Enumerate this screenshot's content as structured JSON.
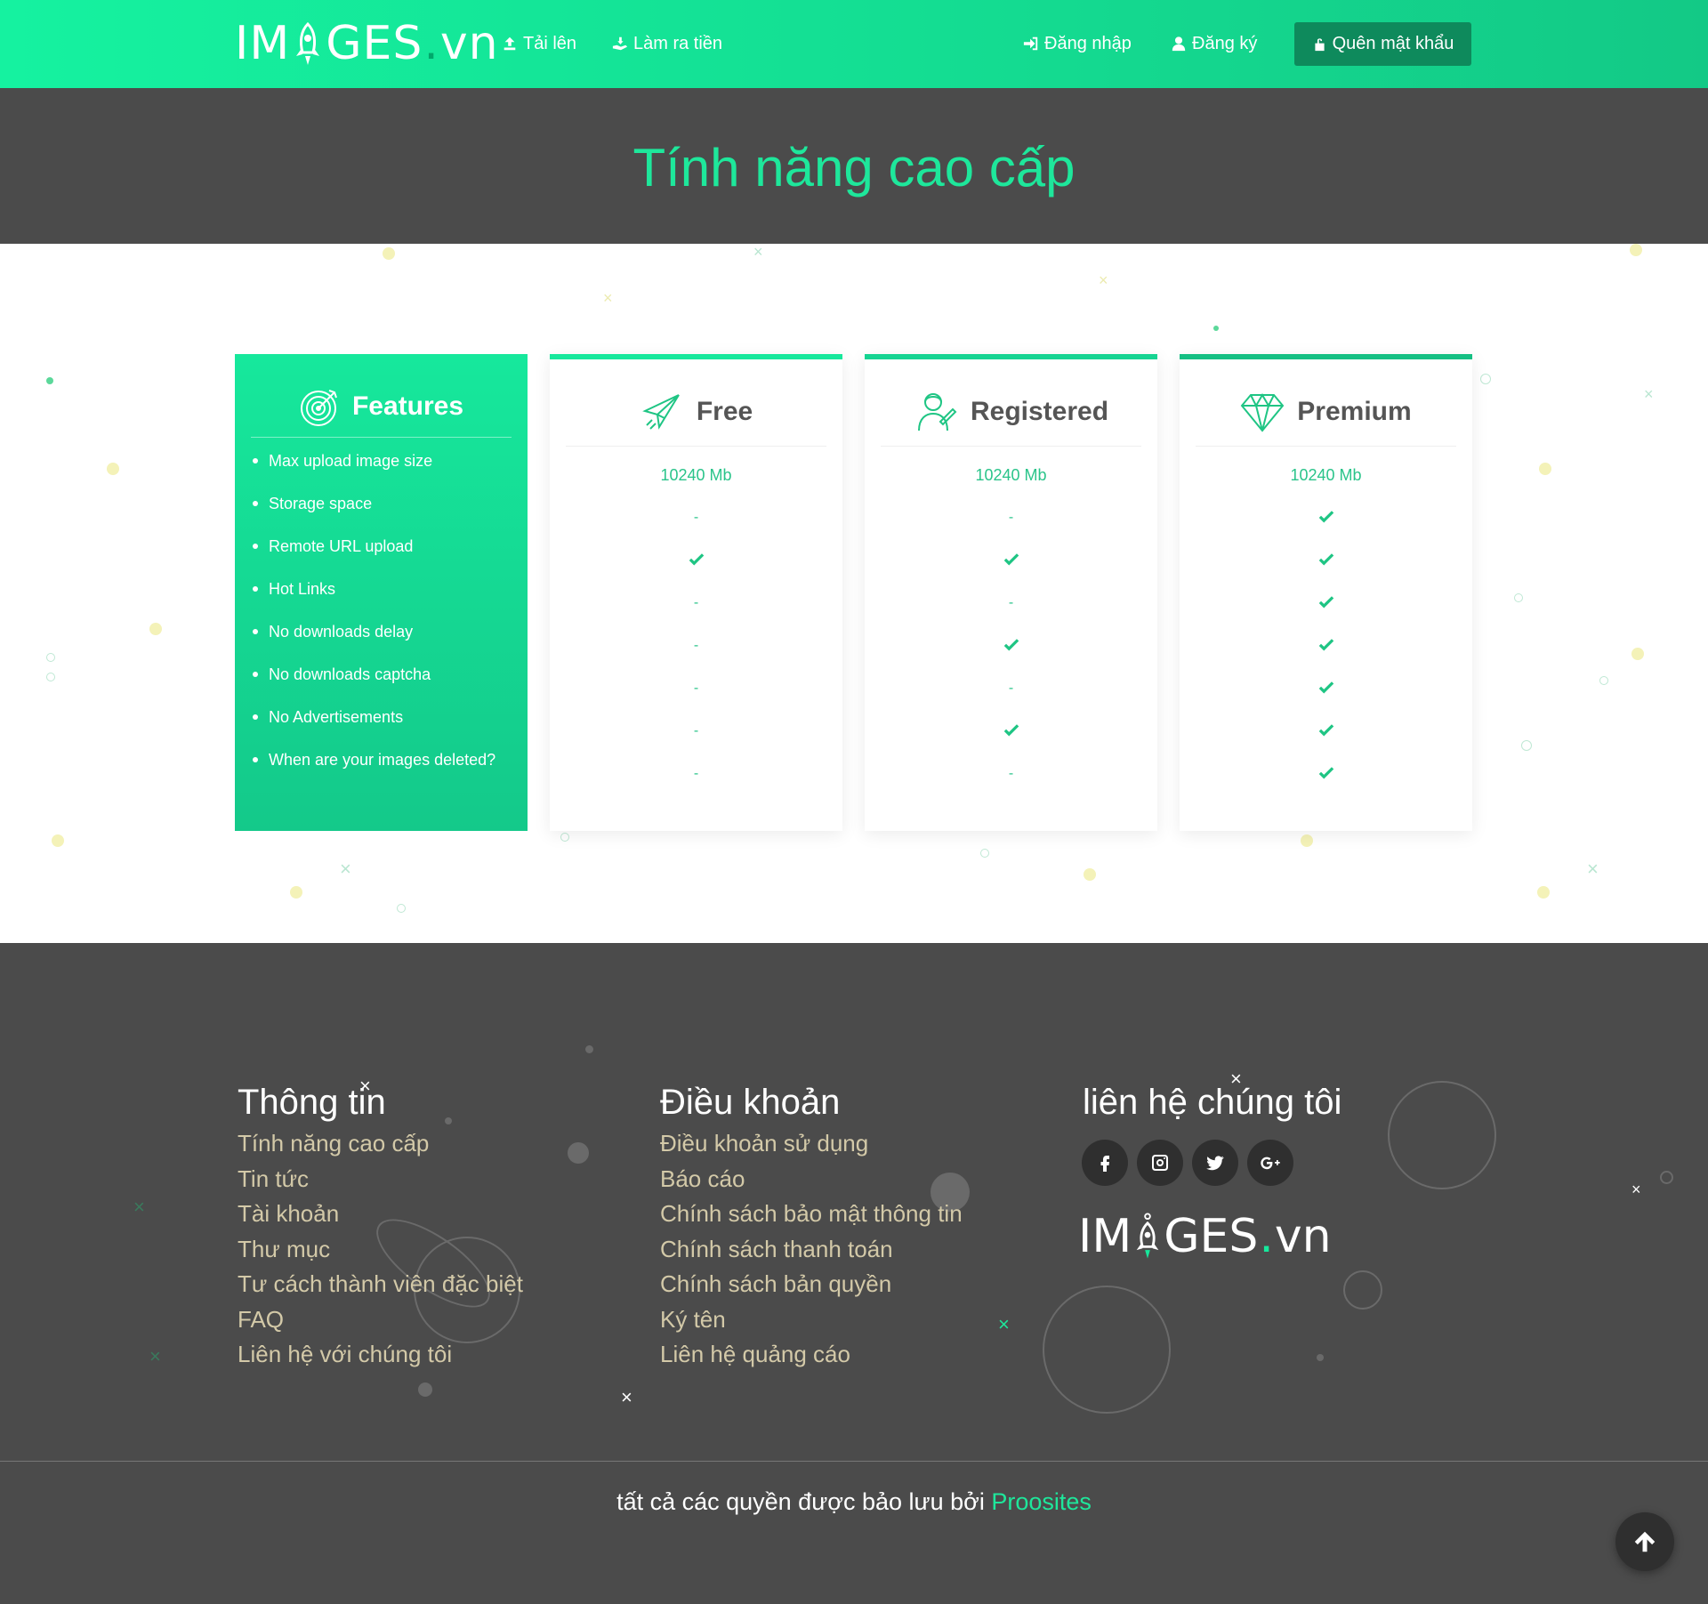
{
  "nav": {
    "logo": {
      "part1": "IM",
      "part2": "GES",
      "dot": ".",
      "tld": "vn"
    },
    "upload_label": "Tải lên",
    "earn_label": "Làm ra tiền",
    "login_label": "Đăng nhập",
    "register_label": "Đăng ký",
    "forgot_label": "Quên mật khẩu",
    "colors": {
      "bar": "#15f2a0",
      "button": "#0e8a5c"
    }
  },
  "hero": {
    "title": "Tính năng cao cấp"
  },
  "features": {
    "heading": "Features",
    "items": [
      "Max upload image size",
      "Storage space",
      "Remote URL upload",
      "Hot Links",
      "No downloads delay",
      "No downloads captcha",
      "No Advertisements",
      "When are your images deleted?"
    ]
  },
  "plans": [
    {
      "name": "Free",
      "icon": "paper-plane-icon",
      "size": "10240 Mb",
      "values": [
        "-",
        "check",
        "-",
        "-",
        "-",
        "-",
        "-"
      ]
    },
    {
      "name": "Registered",
      "icon": "user-icon",
      "size": "10240 Mb",
      "values": [
        "-",
        "check",
        "-",
        "check",
        "-",
        "check",
        "-"
      ]
    },
    {
      "name": "Premium",
      "icon": "diamond-icon",
      "size": "10240 Mb",
      "values": [
        "check",
        "check",
        "check",
        "check",
        "check",
        "check",
        "check"
      ]
    }
  ],
  "footer": {
    "info": {
      "title": "Thông tin",
      "links": [
        "Tính năng cao cấp",
        "Tin tức",
        "Tài khoản",
        "Thư mục",
        "Tư cách thành viên đặc biệt",
        "FAQ",
        "Liên hệ với chúng tôi"
      ]
    },
    "terms": {
      "title": "Điều khoản",
      "links": [
        "Điều khoản sử dụng",
        "Báo cáo",
        "Chính sách bảo mật thông tin",
        "Chính sách thanh toán",
        "Chính sách bản quyền",
        "Ký tên",
        "Liên hệ quảng cáo"
      ]
    },
    "contact": {
      "title": "liên hệ chúng tôi",
      "social": [
        "facebook-icon",
        "instagram-icon",
        "twitter-icon",
        "google-plus-icon"
      ]
    },
    "logo": {
      "part1": "IM",
      "part2": "GES",
      "dot": ".",
      "tld": "vn"
    }
  },
  "copyright": {
    "text": "tất cả các quyền được bảo lưu bởi",
    "brand": "Proosites"
  },
  "colors": {
    "accent": "#1ee79b",
    "dark": "#4b4b4b",
    "link": "#d3c9a8"
  }
}
